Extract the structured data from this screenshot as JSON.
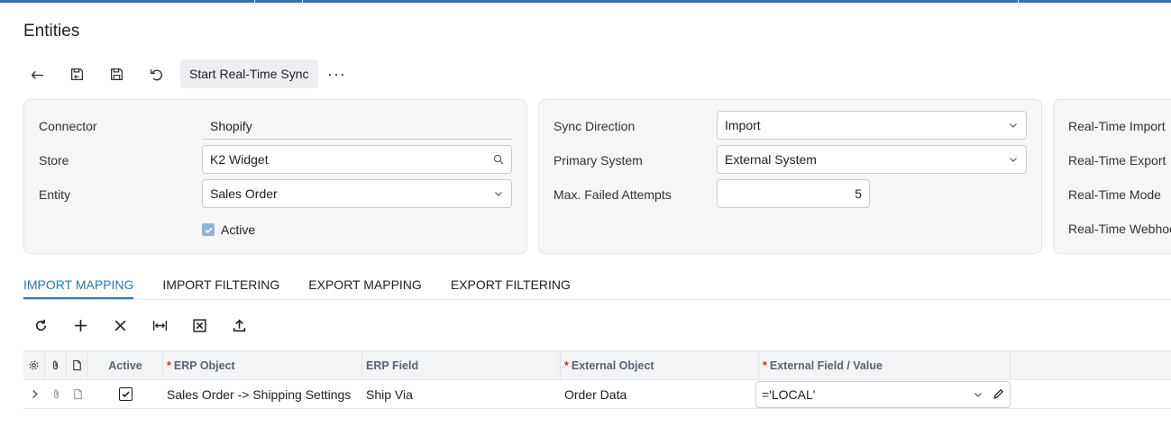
{
  "page": {
    "title": "Entities"
  },
  "toolbar": {
    "back_icon": "back-arrow-icon",
    "save_close_icon": "save-close-icon",
    "save_icon": "save-icon",
    "undo_icon": "undo-icon",
    "sync_label": "Start Real-Time Sync",
    "more_label": "···"
  },
  "panel_left": {
    "connector_label": "Connector",
    "connector_value": "Shopify",
    "store_label": "Store",
    "store_value": "K2 Widget",
    "entity_label": "Entity",
    "entity_value": "Sales Order",
    "active_label": "Active",
    "active_checked": true
  },
  "panel_mid": {
    "sync_direction_label": "Sync Direction",
    "sync_direction_value": "Import",
    "primary_system_label": "Primary System",
    "primary_system_value": "External System",
    "max_failed_label": "Max. Failed Attempts",
    "max_failed_value": "5"
  },
  "panel_right": {
    "rt_import_label": "Real-Time Import",
    "rt_export_label": "Real-Time Export",
    "rt_mode_label": "Real-Time Mode",
    "rt_webhook_label": "Real-Time Webhoo"
  },
  "tabs": [
    {
      "label": "IMPORT MAPPING",
      "active": true
    },
    {
      "label": "IMPORT FILTERING",
      "active": false
    },
    {
      "label": "EXPORT MAPPING",
      "active": false
    },
    {
      "label": "EXPORT FILTERING",
      "active": false
    }
  ],
  "grid": {
    "columns": {
      "active": "Active",
      "erp_object": "ERP Object",
      "erp_field": "ERP Field",
      "external_object": "External Object",
      "external_field": "External Field / Value"
    },
    "rows": [
      {
        "active": true,
        "erp_object": "Sales Order -> Shipping Settings",
        "erp_field": "Ship Via",
        "external_object": "Order Data",
        "external_field": "='LOCAL'"
      }
    ]
  },
  "colors": {
    "accent": "#2f74b5",
    "required": "#d0312d",
    "panel_bg": "#f5f6f8"
  }
}
